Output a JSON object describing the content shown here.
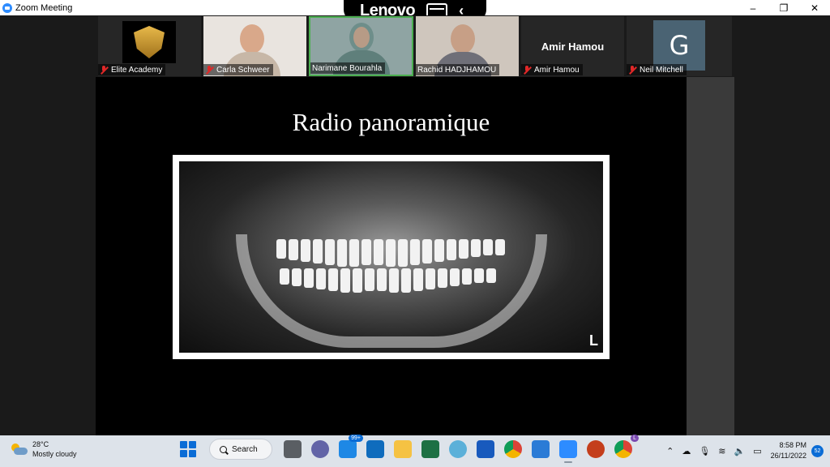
{
  "window": {
    "title": "Zoom Meeting",
    "controls": [
      "–",
      "❐",
      "✕"
    ]
  },
  "overlay": {
    "brand": "Lenovo"
  },
  "participants": [
    {
      "name": "Elite Academy",
      "muted": true
    },
    {
      "name": "Carla Schweer",
      "muted": true
    },
    {
      "name": "Narimane Bourahla",
      "muted": false,
      "active": true
    },
    {
      "name": "Rachid HADJHAMOU",
      "muted": false
    },
    {
      "name": "Amir Hamou",
      "display": "Amir Hamou",
      "muted": true
    },
    {
      "name": "Neil Mitchell",
      "avatar_letter": "G",
      "muted": true
    }
  ],
  "slide": {
    "title": "Radio panoramique",
    "xray_label": "L"
  },
  "taskbar": {
    "weather_temp": "28°C",
    "weather_desc": "Mostly cloudy",
    "search_label": "Search",
    "mail_badge": "99+",
    "chrome_badge": "L",
    "time": "8:58 PM",
    "date": "26/11/2022",
    "notifications": "52"
  }
}
